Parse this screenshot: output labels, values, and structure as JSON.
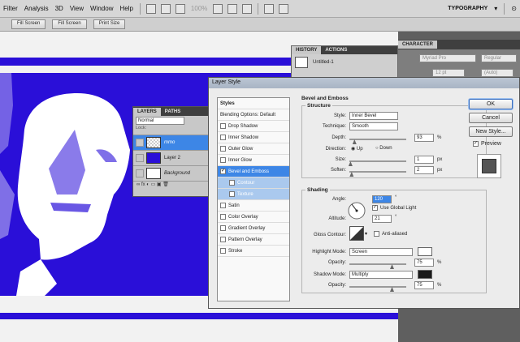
{
  "menubar": {
    "items": [
      "Filter",
      "Analysis",
      "3D",
      "View",
      "Window",
      "Help"
    ],
    "zoom": "100%",
    "workspace": "TYPOGRAPHY"
  },
  "optionsbar": {
    "buttons": [
      "Fill Screen",
      "Fill Screen",
      "Print Size"
    ]
  },
  "history": {
    "tabs": [
      "HISTORY",
      "ACTIONS"
    ],
    "snapshot": "Untitled-1"
  },
  "character": {
    "tab": "CHARACTER",
    "font": "Myriad Pro",
    "style": "Regular",
    "size": "12 pt",
    "leading": "(Auto)"
  },
  "layers": {
    "tabs": [
      "LAYERS",
      "PATHS"
    ],
    "blend": "Normal",
    "lock": "Lock:",
    "rows": [
      {
        "name": "mmo"
      },
      {
        "name": "Layer 2"
      },
      {
        "name": "Background"
      }
    ]
  },
  "dialog": {
    "title": "Layer Style",
    "styles": [
      {
        "label": "Styles"
      },
      {
        "label": "Blending Options: Default"
      },
      {
        "label": "Drop Shadow"
      },
      {
        "label": "Inner Shadow"
      },
      {
        "label": "Outer Glow"
      },
      {
        "label": "Inner Glow"
      },
      {
        "label": "Bevel and Emboss"
      },
      {
        "label": "Contour"
      },
      {
        "label": "Texture"
      },
      {
        "label": "Satin"
      },
      {
        "label": "Color Overlay"
      },
      {
        "label": "Gradient Overlay"
      },
      {
        "label": "Pattern Overlay"
      },
      {
        "label": "Stroke"
      }
    ],
    "bevel": {
      "title": "Bevel and Emboss",
      "structure": "Structure",
      "style_label": "Style:",
      "style": "Inner Bevel",
      "technique_label": "Technique:",
      "technique": "Smooth",
      "depth_label": "Depth:",
      "depth": "93",
      "depth_pct": 0.09,
      "direction_label": "Direction:",
      "up": "Up",
      "down": "Down",
      "size_label": "Size:",
      "size": "1",
      "size_pct": 0.02,
      "soften_label": "Soften:",
      "soften": "2",
      "soften_pct": 0.04,
      "px": "px",
      "pct": "%"
    },
    "shading": {
      "title": "Shading",
      "angle_label": "Angle:",
      "angle": "120",
      "deg": "°",
      "global_light": "Use Global Light",
      "altitude_label": "Altitude:",
      "altitude": "21",
      "gloss_label": "Gloss Contour:",
      "anti_aliased": "Anti-aliased",
      "highlight_label": "Highlight Mode:",
      "highlight_mode": "Screen",
      "highlight_color": "#ffffff",
      "opacity_label": "Opacity:",
      "highlight_opacity": "75",
      "highlight_pct": 0.75,
      "shadow_label": "Shadow Mode:",
      "shadow_mode": "Multiply",
      "shadow_color": "#1a1a1a",
      "shadow_opacity": "75",
      "shadow_pct": 0.75
    },
    "buttons": {
      "ok": "OK",
      "cancel": "Cancel",
      "new_style": "New Style...",
      "preview": "Preview"
    }
  },
  "colors": {
    "canvas_blue": "#2a0fd8",
    "selection": "#3d86e6"
  }
}
